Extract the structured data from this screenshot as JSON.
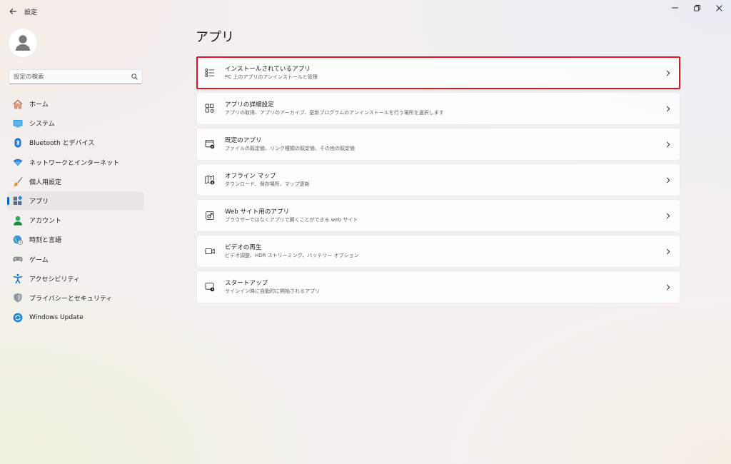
{
  "window": {
    "title": "設定",
    "controls": [
      "minimize-icon",
      "restore-icon",
      "close-icon"
    ]
  },
  "sidebar": {
    "search": {
      "placeholder": "設定の検索",
      "value": ""
    },
    "items": [
      {
        "label": "ホーム",
        "icon": "home-icon"
      },
      {
        "label": "システム",
        "icon": "system-monitor-icon"
      },
      {
        "label": "Bluetooth とデバイス",
        "icon": "bluetooth-icon"
      },
      {
        "label": "ネットワークとインターネット",
        "icon": "wifi-icon"
      },
      {
        "label": "個人用設定",
        "icon": "paintbrush-icon"
      },
      {
        "label": "アプリ",
        "icon": "apps-icon",
        "selected": true
      },
      {
        "label": "アカウント",
        "icon": "account-icon"
      },
      {
        "label": "時刻と言語",
        "icon": "globe-clock-icon"
      },
      {
        "label": "ゲーム",
        "icon": "gamepad-icon"
      },
      {
        "label": "アクセシビリティ",
        "icon": "accessibility-icon"
      },
      {
        "label": "プライバシーとセキュリティ",
        "icon": "shield-icon"
      },
      {
        "label": "Windows Update",
        "icon": "windows-update-icon"
      }
    ]
  },
  "main": {
    "title": "アプリ",
    "cards": [
      {
        "title": "インストールされているアプリ",
        "subtitle": "PC 上のアプリのアンインストールと管理",
        "icon": "installed-apps-list-icon",
        "highlighted": true
      },
      {
        "title": "アプリの詳細設定",
        "subtitle": "アプリの取得、アプリのアーカイブ、更新プログラムのアンインストールを行う場所を選択します",
        "icon": "advanced-app-settings-icon"
      },
      {
        "title": "既定のアプリ",
        "subtitle": "ファイルの既定値、リンク種類の既定値、その他の既定値",
        "icon": "default-apps-icon"
      },
      {
        "title": "オフライン マップ",
        "subtitle": "ダウンロード、保存場所、マップ更新",
        "icon": "offline-map-icon"
      },
      {
        "title": "Web サイト用のアプリ",
        "subtitle": "ブラウザーではなくアプリで開くことができる web サイト",
        "icon": "apps-for-websites-icon"
      },
      {
        "title": "ビデオの再生",
        "subtitle": "ビデオ調整、HDR ストリーミング、バッテリー オプション",
        "icon": "video-camera-icon"
      },
      {
        "title": "スタートアップ",
        "subtitle": "サインイン時に自動的に開始されるアプリ",
        "icon": "startup-icon"
      }
    ]
  },
  "colors": {
    "accent": "#0067c0",
    "highlight_border": "#e0141e"
  }
}
